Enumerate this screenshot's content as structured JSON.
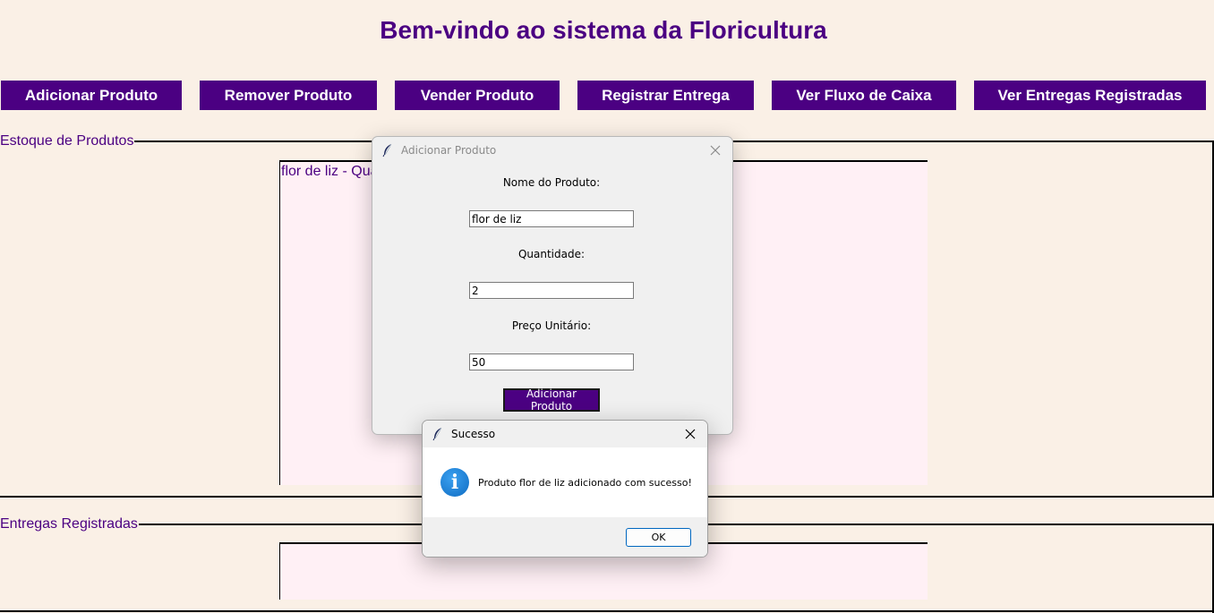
{
  "header": {
    "title": "Bem-vindo ao sistema da Floricultura"
  },
  "nav": {
    "add_product": "Adicionar Produto",
    "remove_product": "Remover Produto",
    "sell_product": "Vender Produto",
    "register_delivery": "Registrar Entrega",
    "cash_flow": "Ver Fluxo de Caixa",
    "view_deliveries": "Ver Entregas Registradas"
  },
  "stock": {
    "label": "Estoque de Produtos",
    "items": [
      "flor de liz - Qua"
    ]
  },
  "deliveries": {
    "label": "Entregas Registradas",
    "items": []
  },
  "add_dialog": {
    "title": "Adicionar Produto",
    "name_label": "Nome do Produto:",
    "name_value": "flor de liz",
    "qty_label": "Quantidade:",
    "qty_value": "2",
    "price_label": "Preço Unitário:",
    "price_value": "50",
    "submit_label": "Adicionar Produto"
  },
  "success_dialog": {
    "title": "Sucesso",
    "message": "Produto flor de liz adicionado com sucesso!",
    "ok_label": "OK",
    "icon": "info-icon"
  },
  "colors": {
    "accent": "#4b0082",
    "background": "#faf0e6",
    "listbox": "#fff0f5",
    "dialog": "#f0f0f0"
  }
}
